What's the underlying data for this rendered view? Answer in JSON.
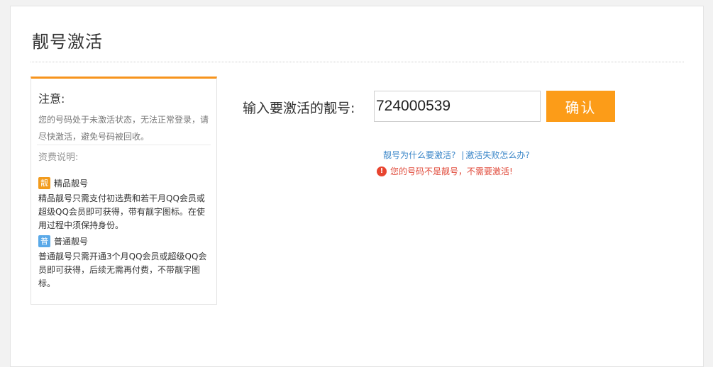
{
  "header": {
    "title": "靓号激活"
  },
  "notice": {
    "title": "注意:",
    "text": "您的号码处于未激活状态，无法正常登录，请尽快激活，避免号码被回收。",
    "fee_title": "资费说明:",
    "tiers": [
      {
        "badge": "靓",
        "name": "精品靓号",
        "description": "精品靓号只需支付初选费和若干月QQ会员或超级QQ会员即可获得，带有靓字图标。在使用过程中须保持身份。"
      },
      {
        "badge": "普",
        "name": "普通靓号",
        "description": "普通靓号只需开通3个月QQ会员或超级QQ会员即可获得，后续无需再付费，不带靓字图标。"
      }
    ]
  },
  "form": {
    "label": "输入要激活的靓号:",
    "input_value": "724000539",
    "confirm_label": "确认"
  },
  "help": {
    "why_link": "靓号为什么要激活?",
    "separator": "|",
    "fail_link": "激活失败怎么办?"
  },
  "error": {
    "icon": "!",
    "message": "您的号码不是靓号，不需要激活!"
  },
  "colors": {
    "accent": "#fc9c18",
    "premium_badge": "#f29b1d",
    "normal_badge": "#5aa9e8",
    "link": "#3a86c8",
    "error": "#e04a3a"
  }
}
